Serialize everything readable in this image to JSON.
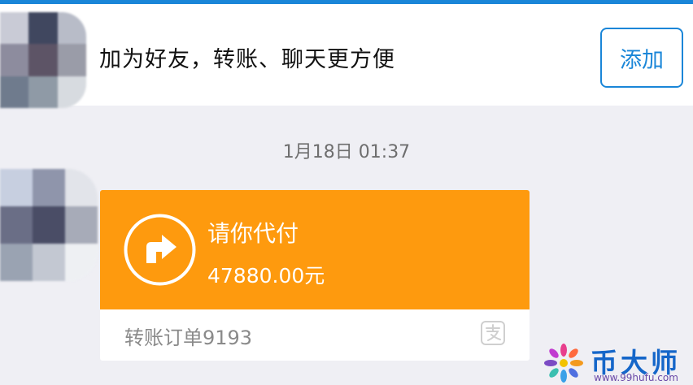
{
  "banner": {
    "text": "加为好友，转账、聊天更方便",
    "add_button_label": "添加"
  },
  "chat": {
    "timestamp": "1月18日 01:37",
    "payment_request": {
      "title": "请你代付",
      "amount": "47880.00元",
      "order": "转账订单9193"
    }
  },
  "watermark": {
    "name": "币大师",
    "site": "www.99hufu.com"
  },
  "colors": {
    "accent": "#1a86d8",
    "card": "#fe9a0e",
    "background": "#efeff4"
  },
  "icons": [
    "transfer-arrow-icon",
    "alipay-icon",
    "flower-logo-icon"
  ]
}
